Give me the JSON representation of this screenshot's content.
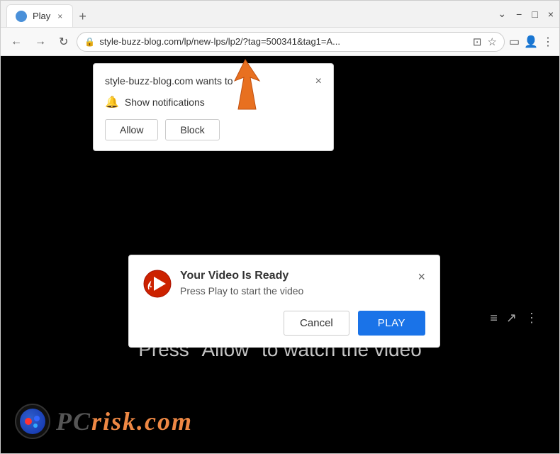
{
  "browser": {
    "tab": {
      "favicon": "play-favicon",
      "label": "Play",
      "close_label": "×"
    },
    "new_tab_button": "+",
    "window_controls": {
      "minimize": "−",
      "maximize": "□",
      "close": "×"
    },
    "address_bar": {
      "url": "style-buzz-blog.com/lp/new-lps/lp2/?tag=500341&tag1=A...",
      "lock_icon": "🔒"
    },
    "nav": {
      "back": "←",
      "forward": "→",
      "refresh": "↻"
    }
  },
  "notification_popup": {
    "title": "style-buzz-blog.com wants to",
    "item_label": "Show notifications",
    "allow_button": "Allow",
    "block_button": "Block",
    "close_label": "×"
  },
  "video_dialog": {
    "title": "Your Video Is Ready",
    "subtitle": "Press Play to start the video",
    "cancel_button": "Cancel",
    "play_button": "PLAY",
    "close_label": "×"
  },
  "page_content": {
    "press_allow_text": "Press \"Allow\" to watch the video",
    "logo_text": "risk.com",
    "logo_brand": "PC"
  },
  "video_controls_icons": [
    "list-icon",
    "share-icon",
    "more-icon"
  ]
}
